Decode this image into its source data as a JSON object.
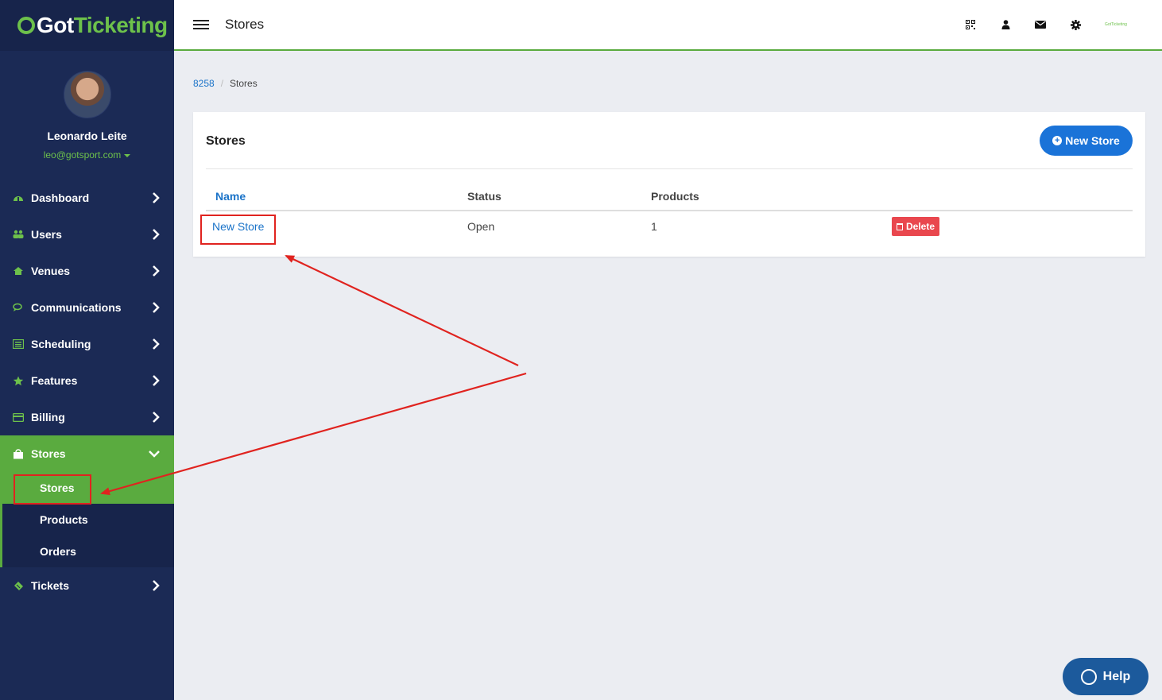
{
  "app": {
    "brand_left": "Got",
    "brand_right": "Ticketing",
    "accent_color": "#5aab3f",
    "sidebar_color": "#1b2a55",
    "primary_color": "#1a73d8",
    "danger_color": "#e9474e"
  },
  "profile": {
    "name": "Leonardo Leite",
    "email": "leo@gotsport.com"
  },
  "nav": {
    "dashboard": "Dashboard",
    "users": "Users",
    "venues": "Venues",
    "communications": "Communications",
    "scheduling": "Scheduling",
    "features": "Features",
    "billing": "Billing",
    "stores": "Stores",
    "stores_sub": [
      "Stores",
      "Products",
      "Orders"
    ],
    "tickets": "Tickets"
  },
  "topbar": {
    "title": "Stores",
    "icons": [
      "qr-code-icon",
      "user-icon",
      "envelope-icon",
      "gear-icon"
    ],
    "mini_logo": "GotTicketing"
  },
  "breadcrumb": {
    "root": "8258",
    "current": "Stores"
  },
  "card": {
    "title": "Stores",
    "new_button": "New Store",
    "columns": [
      "Name",
      "Status",
      "Products"
    ],
    "rows": [
      {
        "name": "New Store",
        "status": "Open",
        "products": "1",
        "action": "Delete"
      }
    ]
  },
  "help": {
    "label": "Help"
  }
}
